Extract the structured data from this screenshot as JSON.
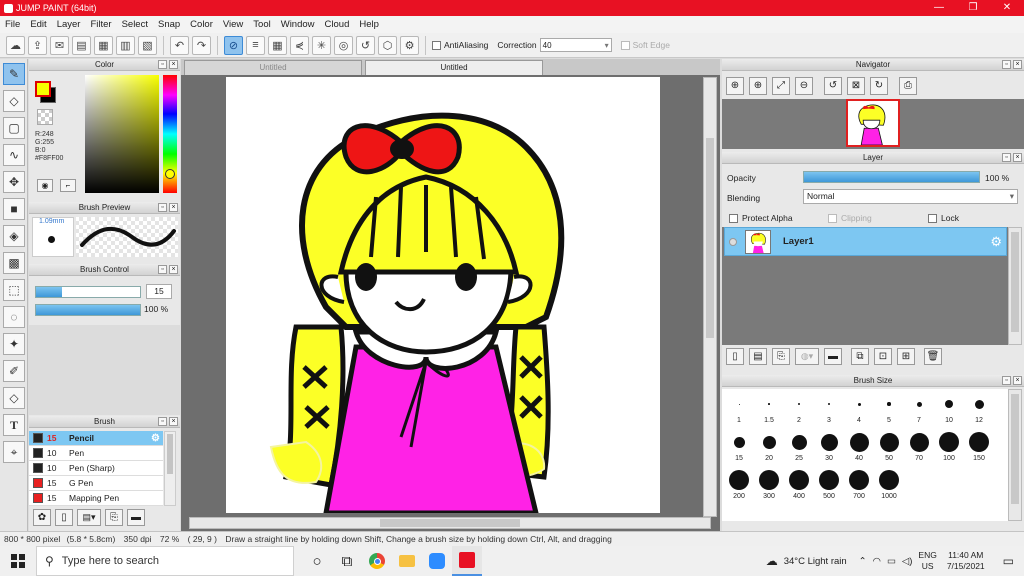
{
  "app": {
    "title": "JUMP PAINT (64bit)",
    "min": "—",
    "max": "❐",
    "close": "✕"
  },
  "menu": [
    "File",
    "Edit",
    "Layer",
    "Filter",
    "Select",
    "Snap",
    "Color",
    "View",
    "Tool",
    "Window",
    "Cloud",
    "Help"
  ],
  "toolbar": {
    "antialiasing_label": "AntiAliasing",
    "correction_label": "Correction",
    "correction_value": "40",
    "soft_edge_label": "Soft Edge"
  },
  "color_panel": {
    "title": "Color",
    "r": "R:248",
    "g": "G:255",
    "b": "B:0",
    "hex": "#F8FF00",
    "fg_color": "#F8FF00",
    "bg_color": "#000000"
  },
  "brush_preview": {
    "title": "Brush Preview",
    "size": "1.09mm"
  },
  "brush_control": {
    "title": "Brush Control",
    "size_value": "15",
    "opacity_value": "100",
    "opacity_unit": "%",
    "size_level": 0.25,
    "opacity_level": 1.0
  },
  "brush_panel": {
    "title": "Brush",
    "items": [
      {
        "size": "15",
        "name": "Pencil",
        "active": true,
        "color": "#222222"
      },
      {
        "size": "10",
        "name": "Pen",
        "active": false,
        "color": "#222222"
      },
      {
        "size": "10",
        "name": "Pen (Sharp)",
        "active": false,
        "color": "#222222"
      },
      {
        "size": "15",
        "name": "G Pen",
        "active": false,
        "color": "#e82020"
      },
      {
        "size": "15",
        "name": "Mapping Pen",
        "active": false,
        "color": "#e82020"
      }
    ]
  },
  "canvas": {
    "tabs": [
      {
        "label": "Untitled",
        "active": false
      },
      {
        "label": "Untitled",
        "active": true
      }
    ]
  },
  "navigator": {
    "title": "Navigator"
  },
  "layer_panel": {
    "title": "Layer",
    "opacity_label": "Opacity",
    "opacity_value": "100",
    "opacity_unit": "%",
    "blending_label": "Blending",
    "blending_value": "Normal",
    "protect_alpha_label": "Protect Alpha",
    "clipping_label": "Clipping",
    "lock_label": "Lock",
    "layers": [
      {
        "name": "Layer1"
      }
    ]
  },
  "brush_size_panel": {
    "title": "Brush Size",
    "sizes": [
      "1",
      "1.5",
      "2",
      "3",
      "4",
      "5",
      "7",
      "10",
      "12",
      "15",
      "20",
      "25",
      "30",
      "40",
      "50",
      "70",
      "100",
      "150",
      "200",
      "300",
      "400",
      "500",
      "700",
      "1000"
    ]
  },
  "status": {
    "dimensions": "800 * 800 pixel",
    "physical_size": "(5.8 * 5.8cm)",
    "dpi": "350 dpi",
    "zoom": "72 %",
    "cursor": "( 29, 9 )",
    "hint": "Draw a straight line by holding down Shift, Change a brush size by holding down Ctrl, Alt, and dragging"
  },
  "taskbar": {
    "search_placeholder": "Type here to search",
    "weather": "34°C  Light rain",
    "lang_top": "ENG",
    "lang_bottom": "US",
    "time": "11:40 AM",
    "date": "7/15/2021"
  }
}
